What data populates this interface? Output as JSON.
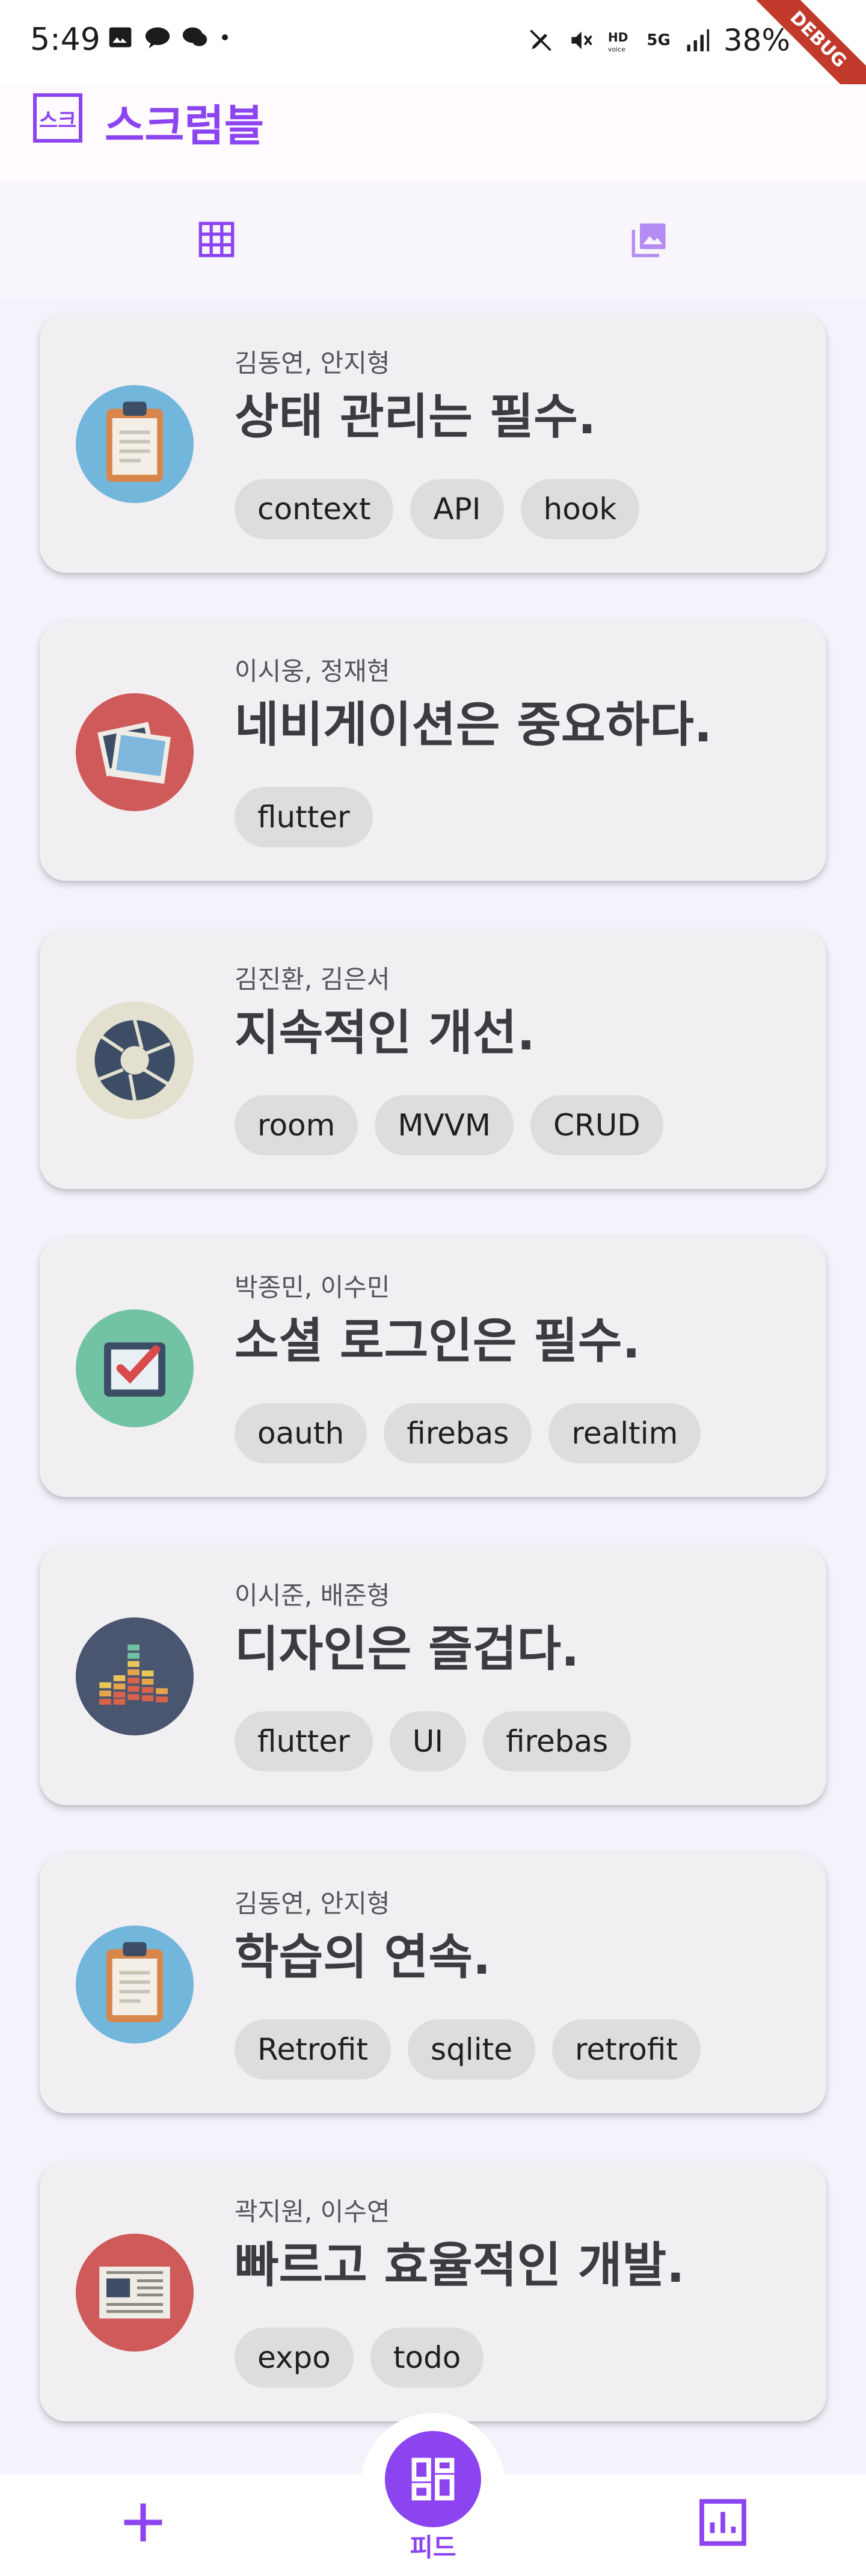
{
  "status_bar": {
    "time": "5:49",
    "battery": "38%",
    "network": "5G",
    "debug_label": "DEBUG"
  },
  "app": {
    "title": "스크럼블",
    "logo_text": "스크",
    "accent_color": "#8b44f0"
  },
  "tabs": [
    {
      "name": "grid-tab",
      "icon": "grid-icon",
      "active": true
    },
    {
      "name": "gallery-tab",
      "icon": "image-icon",
      "active": false
    }
  ],
  "posts": [
    {
      "authors": "김동연, 안지형",
      "title": "상태 관리는 필수.",
      "icon": "clipboard-icon",
      "tags": [
        "context",
        "API",
        "hook"
      ]
    },
    {
      "authors": "이시웅, 정재현",
      "title": "네비게이션은 중요하다.",
      "icon": "photos-icon",
      "tags": [
        "flutter"
      ]
    },
    {
      "authors": "김진환, 김은서",
      "title": "지속적인 개선.",
      "icon": "aperture-icon",
      "tags": [
        "room",
        "MVVM",
        "CRUD"
      ]
    },
    {
      "authors": "박종민, 이수민",
      "title": "소셜 로그인은 필수.",
      "icon": "checkbox-icon",
      "tags": [
        "oauth",
        "firebas",
        "realtim"
      ]
    },
    {
      "authors": "이시준, 배준형",
      "title": "디자인은 즐겁다.",
      "icon": "equalizer-icon",
      "tags": [
        "flutter",
        "UI",
        "firebas"
      ]
    },
    {
      "authors": "김동연, 안지형",
      "title": "학습의 연속.",
      "icon": "clipboard-icon",
      "tags": [
        "Retrofit",
        "sqlite",
        "retrofit"
      ]
    },
    {
      "authors": "곽지원, 이수연",
      "title": "빠르고 효율적인 개발.",
      "icon": "newspaper-icon",
      "tags": [
        "expo",
        "todo"
      ]
    }
  ],
  "bottom_nav": {
    "center_label": "피드",
    "left_icon": "add-icon",
    "center_icon": "dashboard-icon",
    "right_icon": "bar-chart-icon"
  }
}
